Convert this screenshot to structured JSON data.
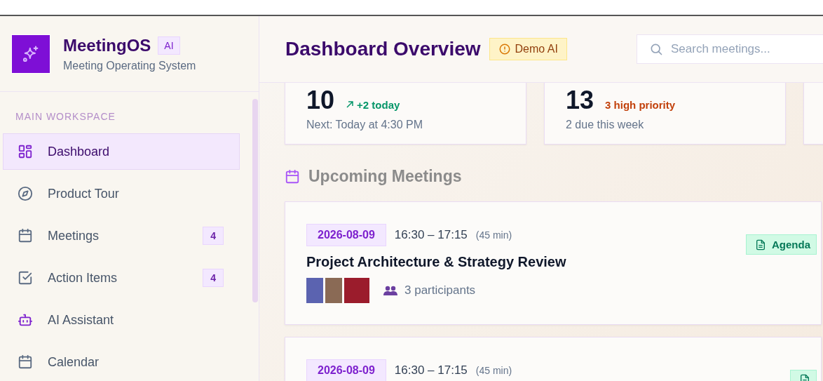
{
  "app": {
    "name": "MeetingOS",
    "badge": "AI",
    "subtitle": "Meeting Operating System"
  },
  "sidebar": {
    "section": "MAIN WORKSPACE",
    "items": [
      {
        "label": "Dashboard",
        "kind": "grid",
        "selected": true
      },
      {
        "label": "Product Tour",
        "kind": "compass",
        "selected": false
      },
      {
        "label": "Meetings",
        "kind": "calendar",
        "selected": false,
        "count": "4"
      },
      {
        "label": "Action Items",
        "kind": "checkbox",
        "selected": false,
        "count": "4"
      },
      {
        "label": "AI Assistant",
        "kind": "robot",
        "selected": false
      },
      {
        "label": "Calendar",
        "kind": "calendar",
        "selected": false
      }
    ]
  },
  "header": {
    "title": "Dashboard Overview",
    "badge": "Demo AI",
    "search": {
      "placeholder": "Search meetings..."
    }
  },
  "stats": [
    {
      "value": "10",
      "trend": "+2 today",
      "kind": "up",
      "note": "Next: Today at 4:30 PM"
    },
    {
      "value": "13",
      "trend": "3 high priority",
      "kind": "warning",
      "note": "2 due this week"
    }
  ],
  "upcoming": {
    "title": "Upcoming Meetings",
    "meetings": [
      {
        "date": "2026-08-09",
        "time": "16:30 – 17:15",
        "duration": "(45 min)",
        "title": "Project Architecture & Strategy Review",
        "participants": "3 participants",
        "avatars": [
          {
            "kind": "photo"
          },
          {
            "kind": "photo"
          },
          {
            "kind": "photo"
          }
        ],
        "tag": {
          "kind": "agenda",
          "label": "Agenda"
        }
      },
      {
        "date": "2026-08-09",
        "time": "16:30 – 17:15",
        "duration": "(45 min)",
        "tag": {
          "kind": "agenda"
        }
      }
    ]
  }
}
